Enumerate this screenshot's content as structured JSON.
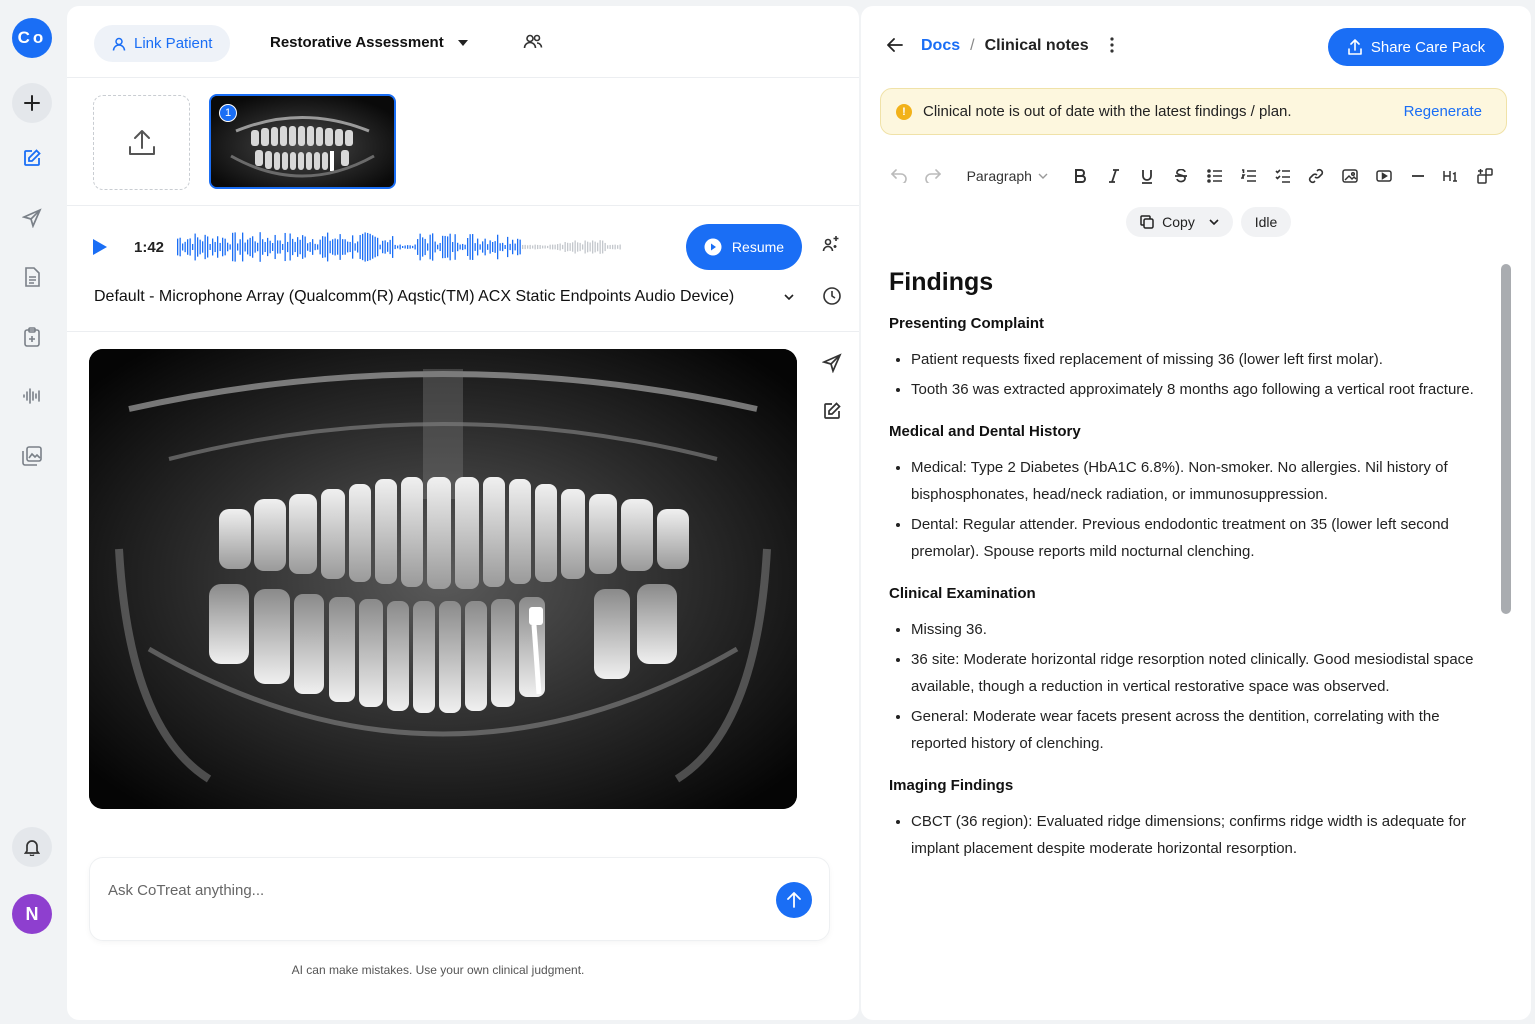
{
  "app": {
    "logo": "Co",
    "avatar_initial": "N"
  },
  "header": {
    "link_patient": "Link Patient",
    "assessment": "Restorative Assessment"
  },
  "audio": {
    "time": "1:42",
    "resume": "Resume",
    "microphone": "Default - Microphone Array (Qualcomm(R) Aqstic(TM) ACX Static Endpoints Audio Device)"
  },
  "thumbnail": {
    "badge": "1"
  },
  "chat": {
    "placeholder": "Ask CoTreat anything...",
    "disclaimer": "AI can make mistakes. Use your own clinical judgment."
  },
  "docs": {
    "breadcrumb_root": "Docs",
    "breadcrumb_sep": "/",
    "breadcrumb_current": "Clinical notes",
    "share": "Share Care Pack",
    "alert_text": "Clinical note is out of date with the latest findings / plan.",
    "alert_action": "Regenerate",
    "paragraph_style": "Paragraph",
    "copy": "Copy",
    "status": "Idle"
  },
  "note": {
    "title": "Findings",
    "sections": [
      {
        "heading": "Presenting Complaint",
        "items": [
          "Patient requests fixed replacement of missing 36 (lower left first molar).",
          "Tooth 36 was extracted approximately 8 months ago following a vertical root fracture."
        ]
      },
      {
        "heading": "Medical and Dental History",
        "items": [
          "Medical: Type 2 Diabetes (HbA1C 6.8%). Non-smoker. No allergies. Nil history of bisphosphonates, head/neck radiation, or immunosuppression.",
          "Dental: Regular attender. Previous endodontic treatment on 35 (lower left second premolar). Spouse reports mild nocturnal clenching."
        ]
      },
      {
        "heading": "Clinical Examination",
        "items": [
          "Missing 36.",
          "36 site: Moderate horizontal ridge resorption noted clinically. Good mesiodistal space available, though a reduction in vertical restorative space was observed.",
          "General: Moderate wear facets present across the dentition, correlating with the reported history of clenching."
        ]
      },
      {
        "heading": "Imaging Findings",
        "items": [
          "CBCT (36 region): Evaluated ridge dimensions; confirms ridge width is adequate for implant placement despite moderate horizontal resorption."
        ]
      }
    ]
  },
  "colors": {
    "accent": "#1a6ef5",
    "alert_bg": "#fdf7de",
    "avatar": "#8e3fcf"
  }
}
